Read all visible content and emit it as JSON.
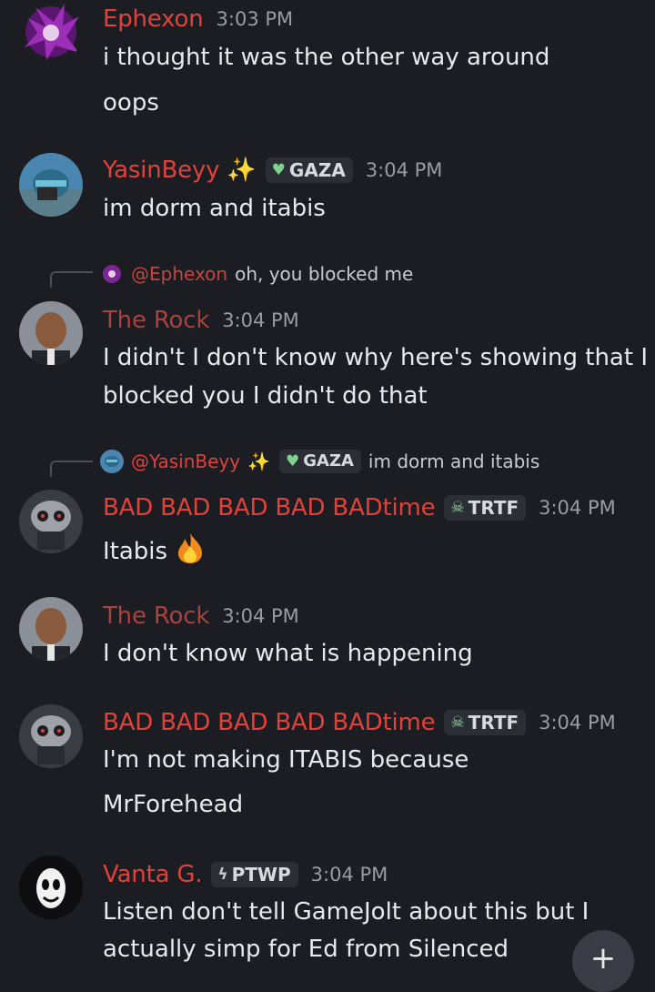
{
  "messages": [
    {
      "author": "Ephexon",
      "author_color": "#e0423a",
      "time": "3:03 PM",
      "lines": [
        "i thought it was the other way around",
        "oops"
      ]
    },
    {
      "author": "YasinBeyy",
      "author_color": "#e0423a",
      "time": "3:04 PM",
      "tag": {
        "icon": "green-heart-icon",
        "label": "GAZA"
      },
      "lines": [
        "im dorm and itabis"
      ]
    },
    {
      "reply": {
        "mention": "@Ephexon",
        "text": "oh, you blocked me"
      },
      "author": "The Rock",
      "author_color": "#a8423e",
      "time": "3:04 PM",
      "lines": [
        "I didn't I don't know why here's showing that I",
        "blocked you I didn't do that"
      ]
    },
    {
      "reply": {
        "mention": "@YasinBeyy",
        "tag_label": "GAZA",
        "text": "im dorm and itabis"
      },
      "author": "BAD BAD BAD BAD BADtime",
      "author_color": "#e0423a",
      "time": "3:04 PM",
      "tag": {
        "icon": "skull-icon",
        "label": "TRTF"
      },
      "lines": [
        "Itabis"
      ]
    },
    {
      "author": "The Rock",
      "author_color": "#a8423e",
      "time": "3:04 PM",
      "lines": [
        "I don't know what is happening"
      ]
    },
    {
      "author": "BAD BAD BAD BAD BADtime",
      "author_color": "#e0423a",
      "time": "3:04 PM",
      "tag": {
        "icon": "skull-icon",
        "label": "TRTF"
      },
      "lines": [
        "I'm not making ITABIS because",
        "MrForehead"
      ]
    },
    {
      "author": "Vanta G.",
      "author_color": "#e0423a",
      "time": "3:04 PM",
      "tag": {
        "icon": "lightning-icon",
        "label": "PTWP"
      },
      "lines": [
        "Listen don't tell GameJolt about this but I",
        "actually simp for Ed from Silenced"
      ]
    }
  ],
  "fab": {
    "icon": "plus-icon",
    "label": "+"
  }
}
